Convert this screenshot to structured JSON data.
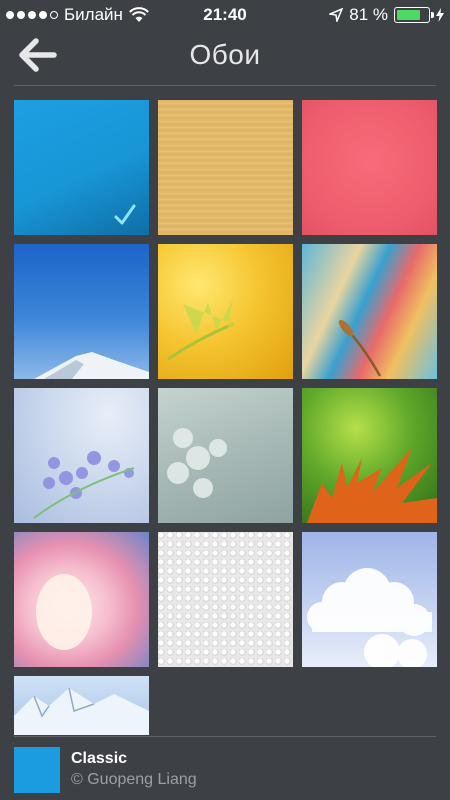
{
  "status_bar": {
    "carrier": "Билайн",
    "time": "21:40",
    "battery_percent_label": "81 %",
    "battery_level": 0.81,
    "signal_bars": 4,
    "icons": [
      "signal-dots-icon",
      "wifi-icon",
      "location-arrow-icon",
      "battery-icon",
      "charging-bolt-icon"
    ]
  },
  "header": {
    "title": "Обои",
    "back_icon": "back-arrow-icon"
  },
  "wallpapers": [
    {
      "name": "blue",
      "selected": true
    },
    {
      "name": "sand"
    },
    {
      "name": "pink"
    },
    {
      "name": "mountain-sky"
    },
    {
      "name": "yellow-fern"
    },
    {
      "name": "prayer-flags-wheat"
    },
    {
      "name": "lilac-blue"
    },
    {
      "name": "lilac-grey"
    },
    {
      "name": "autumn-leaves"
    },
    {
      "name": "cocoon-pink"
    },
    {
      "name": "white-pebbles"
    },
    {
      "name": "clouds"
    },
    {
      "name": "snow-mountains"
    }
  ],
  "footer": {
    "name": "Classic",
    "copyright": "© Guopeng Liang",
    "swatch_color": "#1b9be0"
  },
  "colors": {
    "background": "#3d4145",
    "accent": "#1b9be0",
    "check": "#8fe6ff"
  }
}
